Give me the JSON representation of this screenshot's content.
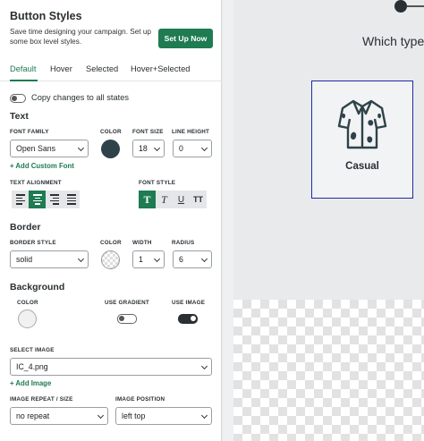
{
  "panel": {
    "title": "Button Styles",
    "description": "Save time designing your campaign. Set up some box level styles.",
    "setup_button": "Set Up Now",
    "tabs": [
      "Default",
      "Hover",
      "Selected",
      "Hover+Selected"
    ],
    "active_tab": "Default",
    "copy_changes": {
      "label": "Copy changes to all states",
      "enabled": false
    },
    "text": {
      "section": "Text",
      "font_family_label": "FONT FAMILY",
      "font_family": "Open Sans",
      "color_label": "COLOR",
      "color": "#2f4249",
      "font_size_label": "FONT SIZE",
      "font_size": "18",
      "line_height_label": "LINE HEIGHT",
      "line_height": "0",
      "add_font": "+ Add Custom Font",
      "alignment_label": "TEXT ALIGNMENT",
      "alignment_selected": "center",
      "font_style_label": "FONT STYLE",
      "font_style_bold": "T",
      "font_style_italic": "T",
      "font_style_underline": "U",
      "font_style_caps": "TT"
    },
    "border": {
      "section": "Border",
      "style_label": "BORDER STYLE",
      "style": "solid",
      "color_label": "COLOR",
      "width_label": "WIDTH",
      "width": "1",
      "radius_label": "RADIUS",
      "radius": "6"
    },
    "background": {
      "section": "Background",
      "color_label": "COLOR",
      "use_gradient_label": "USE GRADIENT",
      "use_gradient": false,
      "use_image_label": "USE IMAGE",
      "use_image": true,
      "select_image_label": "SELECT IMAGE",
      "image": "IC_4.png",
      "add_image": "+ Add Image",
      "repeat_label": "IMAGE REPEAT / SIZE",
      "repeat": "no repeat",
      "position_label": "IMAGE POSITION",
      "position": "left top"
    }
  },
  "preview": {
    "question": "Which type",
    "card_label": "Casual",
    "card_icon": "shirt-icon",
    "card_border_color": "#1f2aa8"
  },
  "colors": {
    "accent": "#1e7b52",
    "dark": "#2a2f33"
  }
}
